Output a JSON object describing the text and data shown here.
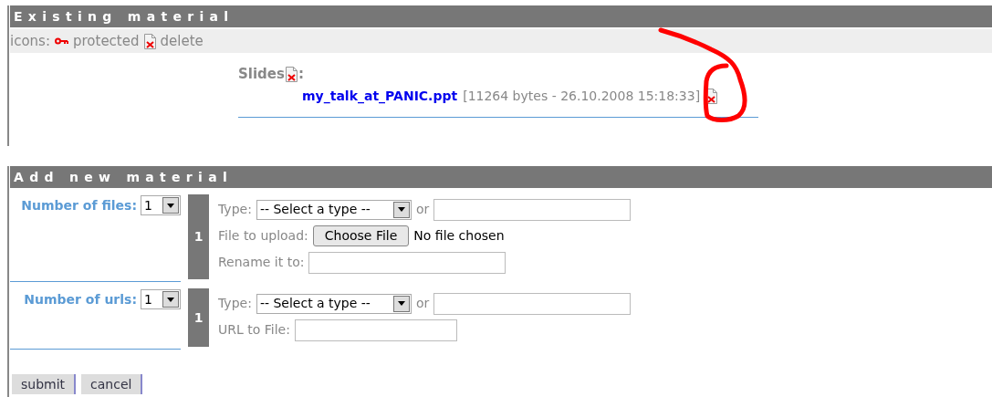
{
  "existing": {
    "title": "Existing material",
    "legend": {
      "label": "icons:",
      "items": [
        {
          "kind": "key",
          "label": "protected"
        },
        {
          "kind": "delete",
          "label": "delete"
        }
      ]
    },
    "groups": [
      {
        "label": "Slides",
        "suffix": ":",
        "files": [
          {
            "name": "my_talk_at_PANIC.ppt",
            "info": "[11264 bytes - 26.10.2008 15:18:33]"
          }
        ]
      }
    ]
  },
  "add": {
    "title": "Add new material",
    "blocks": [
      {
        "label": "Number of files:",
        "count": "1",
        "entries": [
          {
            "number": "1",
            "rows": [
              {
                "kind": "type",
                "label": "Type:",
                "value": "-- Select a type --",
                "or": "or"
              },
              {
                "kind": "file",
                "label": "File to upload:",
                "button": "Choose File",
                "status": "No file chosen"
              },
              {
                "kind": "text",
                "label": "Rename it to:"
              }
            ]
          }
        ]
      },
      {
        "label": "Number of urls:",
        "count": "1",
        "entries": [
          {
            "number": "1",
            "rows": [
              {
                "kind": "type",
                "label": "Type:",
                "value": "-- Select a type --",
                "or": "or"
              },
              {
                "kind": "url",
                "label": "URL to File:"
              }
            ]
          }
        ]
      }
    ]
  },
  "buttons": [
    "submit",
    "cancel"
  ],
  "annotation": {
    "kind": "circle"
  }
}
